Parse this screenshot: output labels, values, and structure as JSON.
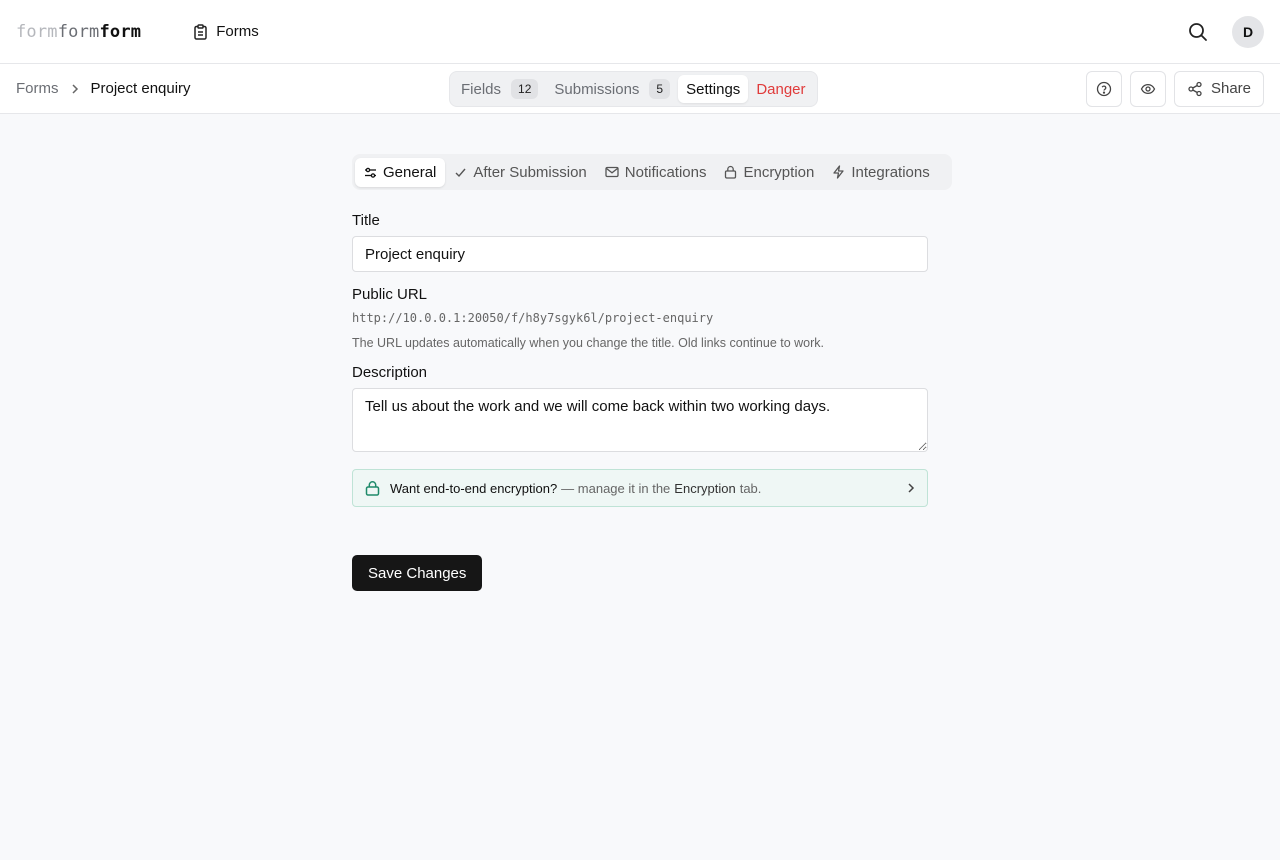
{
  "topbar": {
    "logo": {
      "part1": "form",
      "part2": "form",
      "part3": "form"
    },
    "nav_forms_label": "Forms",
    "avatar_initial": "D"
  },
  "breadcrumb": {
    "root": "Forms",
    "current": "Project enquiry"
  },
  "form_tabs": {
    "fields": {
      "label": "Fields",
      "count": "12"
    },
    "submissions": {
      "label": "Submissions",
      "count": "5"
    },
    "settings": {
      "label": "Settings"
    },
    "danger": {
      "label": "Danger"
    }
  },
  "actions": {
    "share_label": "Share"
  },
  "settings_tabs": [
    {
      "label": "General",
      "icon": "sliders-icon",
      "active": true
    },
    {
      "label": "After Submission",
      "icon": "check-icon"
    },
    {
      "label": "Notifications",
      "icon": "mail-icon"
    },
    {
      "label": "Encryption",
      "icon": "lock-icon"
    },
    {
      "label": "Integrations",
      "icon": "bolt-icon"
    }
  ],
  "general": {
    "title_label": "Title",
    "title_value": "Project enquiry",
    "public_url_label": "Public URL",
    "public_url": "http://10.0.0.1:20050/f/h8y7sgyk6l/project-enquiry",
    "url_help": "The URL updates automatically when you change the title. Old links continue to work.",
    "description_label": "Description",
    "description_value": "Tell us about the work and we will come back within two working days."
  },
  "encryption_banner": {
    "strong": "Want end-to-end encryption?",
    "middle": "— manage it in the",
    "emphasis": "Encryption",
    "end": "tab."
  },
  "save_label": "Save Changes",
  "colors": {
    "accent_green": "#1f8a6a",
    "danger": "#e03b3b",
    "primary_button": "#161616"
  }
}
